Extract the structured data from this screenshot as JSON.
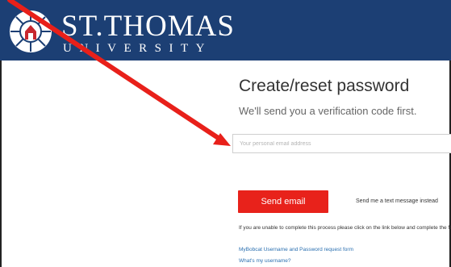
{
  "brand": {
    "name": "ST.THOMAS",
    "subname": "UNIVERSITY"
  },
  "page": {
    "title": "Create/reset password",
    "subtitle": "We'll send you a verification code first."
  },
  "form": {
    "email_placeholder": "Your personal email address",
    "email_value": "",
    "send_button": "Send email",
    "text_option": "Send me a text message instead"
  },
  "help": {
    "info": "If you are unable to complete this process please click on the link below and complete the form.",
    "link_request_form": "MyBobcat Username and Password request form",
    "link_username": "What's my username?"
  },
  "colors": {
    "header_bg": "#1c3f74",
    "button_bg": "#e8221b",
    "link": "#2a6fb0",
    "annotation_arrow": "#e8201a"
  },
  "icons": {
    "logo": "university-seal-icon"
  }
}
